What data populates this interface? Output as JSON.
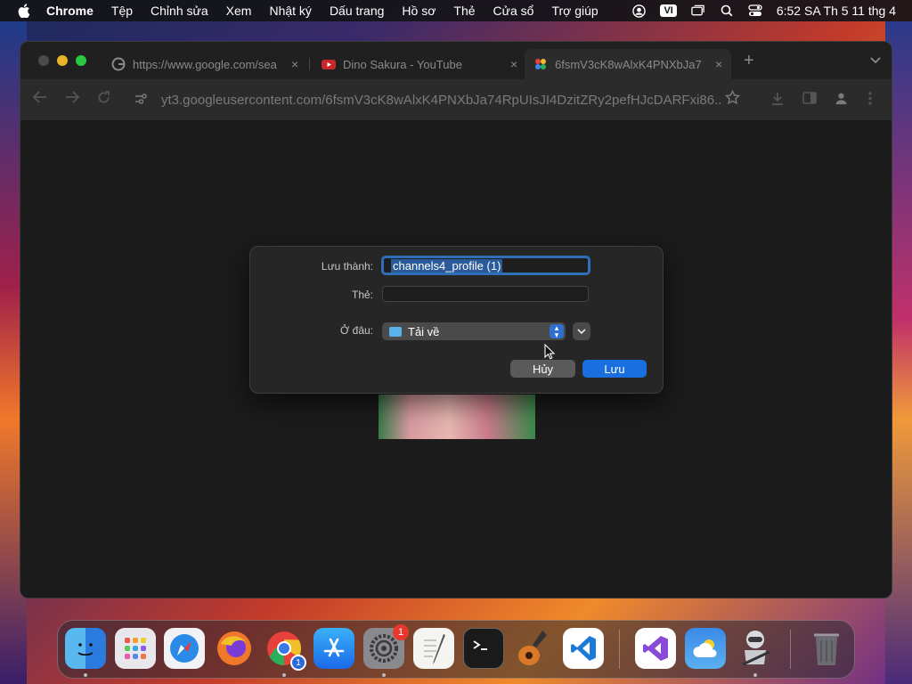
{
  "menubar": {
    "app_name": "Chrome",
    "items": [
      "Tệp",
      "Chỉnh sửa",
      "Xem",
      "Nhật ký",
      "Dấu trang",
      "Hồ sơ",
      "Thẻ",
      "Cửa sổ",
      "Trợ giúp"
    ],
    "input_source": "VI",
    "clock": "6:52 SA Th 5 11 thg 4"
  },
  "browser": {
    "tabs": [
      {
        "title": "https://www.google.com/sea",
        "icon": "google-icon",
        "close": "×"
      },
      {
        "title": "Dino Sakura - YouTube",
        "icon": "youtube-icon",
        "close": "×"
      },
      {
        "title": "6fsmV3cK8wAlxK4PNXbJa7",
        "icon": "google-photos-icon",
        "close": "×"
      }
    ],
    "new_tab": "+",
    "address": "yt3.googleusercontent.com/6fsmV3cK8wAlxK4PNXbJa74RpUIsJI4DzitZRy2pefHJcDARFxi86..."
  },
  "save_dialog": {
    "save_as_label": "Lưu thành:",
    "save_as_value": "channels4_profile (1)",
    "tags_label": "Thẻ:",
    "tags_value": "",
    "where_label": "Ở đâu:",
    "where_value": "Tải về",
    "cancel_label": "Hủy",
    "save_label": "Lưu"
  },
  "dock": {
    "apps": [
      "Finder",
      "Launchpad",
      "Safari",
      "Firefox",
      "Chrome",
      "App Store",
      "System Settings",
      "TextEdit",
      "Terminal",
      "GarageBand",
      "Visual Studio Code",
      "Visual Studio",
      "Weather",
      "Automator",
      "Trash"
    ],
    "system_settings_badge": "1",
    "chrome_windows": "1"
  },
  "colors": {
    "accent": "#1a6fe0",
    "focus_ring": "#2f6fb8"
  }
}
